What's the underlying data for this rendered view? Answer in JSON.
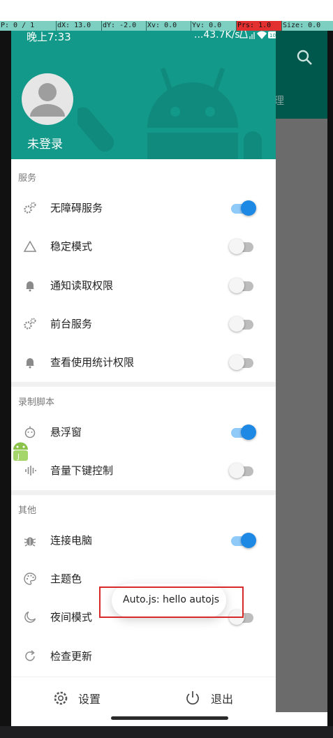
{
  "debug_overlay": [
    "P: 0 / 1",
    "dX: 13.0",
    "dY: -2.0",
    "Xv: 0.0",
    "Yv: 0.0",
    "Prs: 1.0",
    "Size: 0.0"
  ],
  "status_bar": {
    "time": "晚上7:33",
    "net_speed": "...43.7K/s",
    "battery": "100"
  },
  "profile": {
    "login_label": "未登录"
  },
  "background_app": {
    "tab_partial": "理"
  },
  "sections": [
    {
      "label": "服务",
      "items": [
        {
          "label": "无障碍服务",
          "icon": "gears-icon",
          "toggle": true
        },
        {
          "label": "稳定模式",
          "icon": "triangle-icon",
          "toggle": false
        },
        {
          "label": "通知读取权限",
          "icon": "bell-icon",
          "toggle": false
        },
        {
          "label": "前台服务",
          "icon": "gears-icon",
          "toggle": false
        },
        {
          "label": "查看使用统计权限",
          "icon": "bell-icon",
          "toggle": false
        }
      ]
    },
    {
      "label": "录制脚本",
      "items": [
        {
          "label": "悬浮窗",
          "icon": "robot-face-icon",
          "toggle": true
        },
        {
          "label": "音量下键控制",
          "icon": "waveform-icon",
          "toggle": false
        }
      ]
    },
    {
      "label": "其他",
      "items": [
        {
          "label": "连接电脑",
          "icon": "bug-icon",
          "toggle": true
        },
        {
          "label": "主题色",
          "icon": "palette-icon"
        },
        {
          "label": "夜间模式",
          "icon": "moon-icon",
          "toggle": false
        },
        {
          "label": "检查更新",
          "icon": "refresh-icon"
        }
      ]
    }
  ],
  "footer": {
    "settings_label": "设置",
    "exit_label": "退出"
  },
  "toast": {
    "text": "Auto.js: hello autojs"
  },
  "colors": {
    "header": "#13998a",
    "accent": "#1e88e5",
    "highlight": "#d62a2a"
  }
}
